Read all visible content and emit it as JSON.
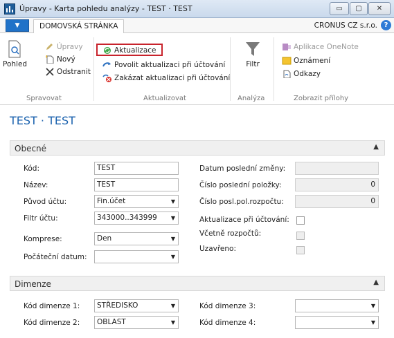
{
  "window": {
    "title": "Úpravy - Karta pohledu analýzy - TEST · TEST",
    "minimize_label": "▭",
    "maximize_label": "▢",
    "close_label": "✕"
  },
  "tabs": {
    "home": "DOMOVSKÁ STRÁNKA",
    "company": "CRONUS CZ s.r.o.",
    "help": "?"
  },
  "ribbon": {
    "manage": {
      "label": "Spravovat",
      "view": "Pohled",
      "edit": "Úpravy",
      "new": "Nový",
      "delete": "Odstranit"
    },
    "update": {
      "label": "Aktualizovat",
      "update": "Aktualizace",
      "enable": "Povolit aktualizaci při účtování",
      "disable": "Zakázat aktualizaci při účtování"
    },
    "analysis": {
      "label": "Analýza",
      "filter": "Filtr"
    },
    "attachments": {
      "label": "Zobrazit přílohy",
      "onenote": "Aplikace OneNote",
      "notes": "Oznámení",
      "links": "Odkazy"
    }
  },
  "page": {
    "title": "TEST · TEST"
  },
  "general": {
    "caption": "Obecné",
    "code_label": "Kód:",
    "code_value": "TEST",
    "name_label": "Název:",
    "name_value": "TEST",
    "account_source_label": "Původ účtu:",
    "account_source_value": "Fin.účet",
    "account_filter_label": "Filtr účtu:",
    "account_filter_value": "343000..343999",
    "compression_label": "Komprese:",
    "compression_value": "Den",
    "start_date_label": "Počáteční datum:",
    "start_date_value": "",
    "last_changed_label": "Datum poslední změny:",
    "last_changed_value": "",
    "last_entry_label": "Číslo poslední položky:",
    "last_entry_value": "0",
    "last_budget_label": "Číslo posl.pol.rozpočtu:",
    "last_budget_value": "0",
    "update_on_posting_label": "Aktualizace při účtování:",
    "include_budgets_label": "Včetně rozpočtů:",
    "blocked_label": "Uzavřeno:"
  },
  "dimensions": {
    "caption": "Dimenze",
    "dim1_label": "Kód dimenze 1:",
    "dim1_value": "STŘEDISKO",
    "dim2_label": "Kód dimenze 2:",
    "dim2_value": "OBLAST",
    "dim3_label": "Kód dimenze 3:",
    "dim3_value": "",
    "dim4_label": "Kód dimenze 4:",
    "dim4_value": ""
  },
  "colors": {
    "accent": "#1b62ae",
    "highlight": "#c8232c",
    "app_button": "#2072c8"
  },
  "icons": {
    "app": "analysis-view-app-icon",
    "view": "document-view-icon",
    "edit": "pencil-icon",
    "new": "new-document-icon",
    "delete": "delete-x-icon",
    "update": "refresh-icon",
    "enable": "arrow-icon",
    "disable": "disable-icon",
    "filter": "funnel-icon",
    "onenote": "onenote-icon",
    "notes": "note-icon",
    "links": "link-document-icon"
  }
}
